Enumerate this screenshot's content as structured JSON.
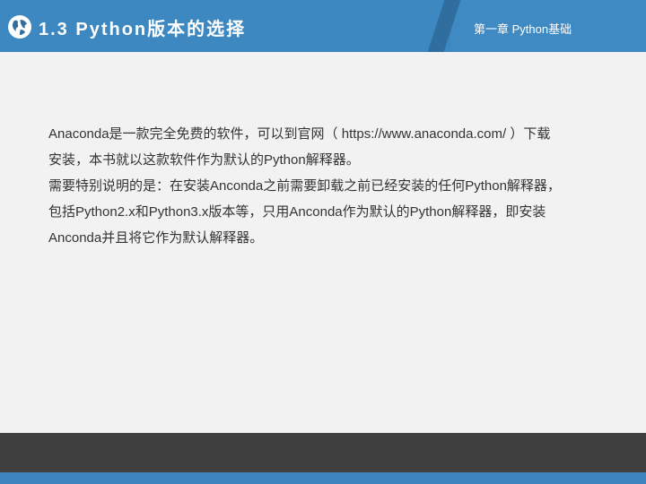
{
  "header": {
    "section_title": "1.3  Python版本的选择",
    "chapter_label": "第一章 Python基础"
  },
  "body": {
    "lines": [
      "Anaconda是一款完全免费的软件，可以到官网（ https://www.anaconda.com/ ）下载",
      "安装，本书就以这款软件作为默认的Python解释器。",
      "需要特别说明的是：在安装Anconda之前需要卸载之前已经安装的任何Python解释器，",
      "包括Python2.x和Python3.x版本等，只用Anconda作为默认的Python解释器，即安装",
      "Anconda并且将它作为默认解释器。"
    ]
  },
  "colors": {
    "header_blue": "#3e86bd",
    "footer_dark": "#404040",
    "background": "#f2f2f2"
  },
  "icons": {
    "header_icon": "globe-icon"
  }
}
